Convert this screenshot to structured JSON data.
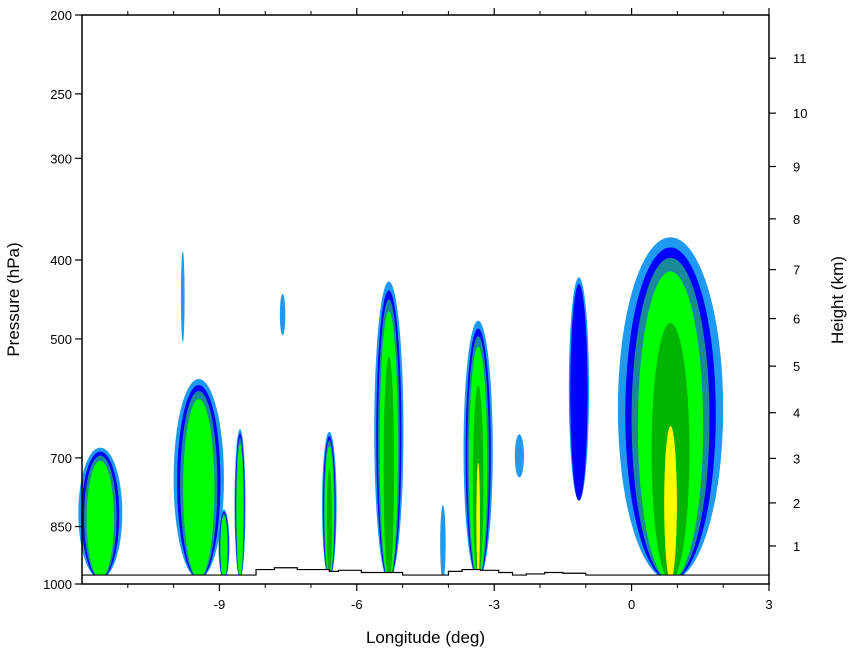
{
  "chart_data": {
    "type": "filled-contour cross-section",
    "xlabel": "Longitude (deg)",
    "ylabel_left": "Pressure (hPa)",
    "ylabel_right": "Height (km)",
    "xlim": [
      -12,
      3
    ],
    "x_ticks": [
      {
        "value": -9,
        "label": "-9"
      },
      {
        "value": -6,
        "label": "-6"
      },
      {
        "value": -3,
        "label": "-3"
      },
      {
        "value": 0,
        "label": "0"
      },
      {
        "value": 3,
        "label": "3"
      }
    ],
    "pressure_axis": {
      "ylim": [
        1000,
        200
      ],
      "scale": "log",
      "ticks": [
        {
          "value": 200,
          "label": "200"
        },
        {
          "value": 250,
          "label": "250"
        },
        {
          "value": 300,
          "label": "300"
        },
        {
          "value": 400,
          "label": "400"
        },
        {
          "value": 500,
          "label": "500"
        },
        {
          "value": 700,
          "label": "700"
        },
        {
          "value": 850,
          "label": "850"
        },
        {
          "value": 1000,
          "label": "1000"
        }
      ]
    },
    "height_axis": {
      "unit": "km",
      "ticks": [
        {
          "value": 1,
          "label": "1",
          "pressure": 898
        },
        {
          "value": 2,
          "label": "2",
          "pressure": 795
        },
        {
          "value": 3,
          "label": "3",
          "pressure": 701
        },
        {
          "value": 4,
          "label": "4",
          "pressure": 616
        },
        {
          "value": 5,
          "label": "5",
          "pressure": 540
        },
        {
          "value": 6,
          "label": "6",
          "pressure": 472
        },
        {
          "value": 7,
          "label": "7",
          "pressure": 411
        },
        {
          "value": 8,
          "label": "8",
          "pressure": 356
        },
        {
          "value": 9,
          "label": "9",
          "pressure": 307
        },
        {
          "value": 10,
          "label": "10",
          "pressure": 264
        },
        {
          "value": 11,
          "label": "11",
          "pressure": 226
        }
      ]
    },
    "contour_levels": [
      {
        "level": 1,
        "color": "#1e9af0"
      },
      {
        "level": 2,
        "color": "#0000ff"
      },
      {
        "level": 3,
        "color": "#1a8a9a"
      },
      {
        "level": 4,
        "color": "#00ff00"
      },
      {
        "level": 5,
        "color": "#00b400"
      },
      {
        "level": 6,
        "color": "#ffff00"
      }
    ],
    "cells": [
      {
        "xc": -11.6,
        "halfwidth": 0.48,
        "base": 985,
        "top": 680,
        "peak": 4
      },
      {
        "xc": -9.45,
        "halfwidth": 0.55,
        "base": 985,
        "top": 560,
        "peak": 4
      },
      {
        "xc": -9.8,
        "halfwidth": 0.04,
        "base": 505,
        "top": 390,
        "peak": 1
      },
      {
        "xc": -8.9,
        "halfwidth": 0.12,
        "base": 990,
        "top": 810,
        "peak": 4
      },
      {
        "xc": -8.55,
        "halfwidth": 0.12,
        "base": 985,
        "top": 645,
        "peak": 4
      },
      {
        "xc": -7.62,
        "halfwidth": 0.06,
        "base": 495,
        "top": 440,
        "peak": 1
      },
      {
        "xc": -6.6,
        "halfwidth": 0.16,
        "base": 985,
        "top": 650,
        "peak": 5
      },
      {
        "xc": -5.3,
        "halfwidth": 0.32,
        "base": 990,
        "top": 425,
        "peak": 5
      },
      {
        "xc": -4.12,
        "halfwidth": 0.06,
        "base": 990,
        "top": 800,
        "peak": 1
      },
      {
        "xc": -3.35,
        "halfwidth": 0.32,
        "base": 985,
        "top": 475,
        "peak": 6
      },
      {
        "xc": -2.45,
        "halfwidth": 0.1,
        "base": 740,
        "top": 655,
        "peak": 1
      },
      {
        "xc": -1.15,
        "halfwidth": 0.22,
        "base": 790,
        "top": 420,
        "peak": 2
      },
      {
        "xc": 0.85,
        "halfwidth": 1.15,
        "base": 990,
        "top": 375,
        "peak": 6
      }
    ],
    "terrain": {
      "x": [
        -12,
        -9.2,
        -9.0,
        -8.2,
        -7.8,
        -7.3,
        -6.6,
        -6.4,
        -5.9,
        -5.0,
        -4.3,
        -4.0,
        -3.7,
        -3.3,
        -2.9,
        -2.6,
        -2.3,
        -1.9,
        -1.5,
        -1.0,
        -0.5,
        -0.3,
        0,
        2,
        3
      ],
      "p": [
        975,
        975,
        975,
        960,
        955,
        960,
        965,
        962,
        968,
        975,
        975,
        965,
        960,
        962,
        968,
        975,
        972,
        968,
        970,
        975,
        975,
        975,
        975,
        975,
        975
      ]
    }
  }
}
